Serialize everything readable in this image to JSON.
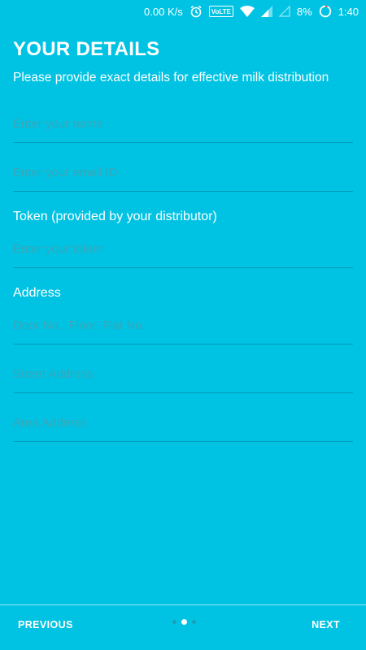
{
  "status_bar": {
    "net_speed": "0.00 K/s",
    "volte": "VoLTE",
    "battery": "8%",
    "time": "1:40"
  },
  "header": {
    "title": "YOUR DETAILS",
    "subtitle": "Please provide exact details for effective milk distribution"
  },
  "form": {
    "name_placeholder": "Enter your name",
    "email_placeholder": "Enter your email ID",
    "token_label": "Token (provided by your distributor)",
    "token_placeholder": "Enter your token",
    "address_label": "Address",
    "door_placeholder": "Door No., Floor, Flat No.",
    "street_placeholder": "Street Address",
    "area_placeholder": "Area Address"
  },
  "nav": {
    "previous_label": "PREVIOUS",
    "next_label": "NEXT",
    "pages": 3,
    "current_page": 2
  },
  "colors": {
    "background": "#00c3e3",
    "placeholder": "#3aa5b8",
    "text": "#ffffff"
  }
}
